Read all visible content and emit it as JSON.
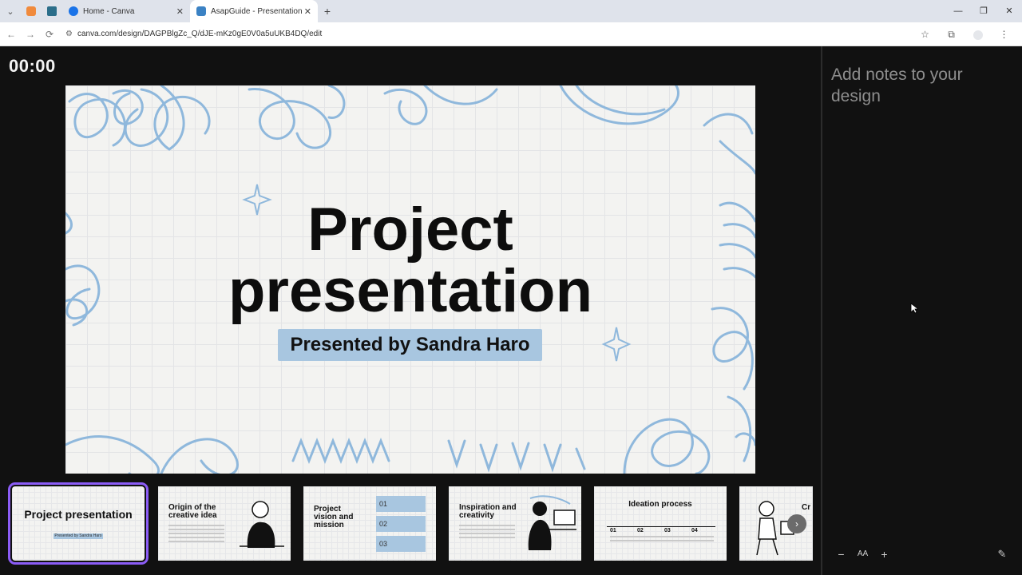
{
  "browser": {
    "tabs": [
      {
        "label": "Home - Canva",
        "active": false
      },
      {
        "label": "AsapGuide - Presentation",
        "active": true
      }
    ],
    "url": "canva.com/design/DAGPBlgZc_Q/dJE-mKz0gE0V0a5uUKB4DQ/edit",
    "icons": {
      "back": "←",
      "forward": "→",
      "reload": "⟳",
      "star": "☆",
      "ext": "⧉",
      "menu": "⋮",
      "minimize": "—",
      "restore": "❐",
      "close": "✕",
      "new_tab": "+",
      "tab_close": "✕",
      "tab_list": "⌄"
    }
  },
  "presenter": {
    "timer": "00:00",
    "slide": {
      "title_line1": "Project",
      "title_line2": "presentation",
      "subtitle": "Presented by Sandra Haro"
    },
    "thumbnails": [
      {
        "title": "Project presentation",
        "subtitle": "Presented by Sandra Haro",
        "selected": true
      },
      {
        "title": "Origin of the creative idea"
      },
      {
        "title": "Project vision and mission",
        "items": [
          "01",
          "02",
          "03"
        ]
      },
      {
        "title": "Inspiration and creativity"
      },
      {
        "title": "Ideation process",
        "steps": [
          "01",
          "02",
          "03",
          "04"
        ]
      },
      {
        "title": "Cr pr"
      }
    ],
    "next_icon": "›"
  },
  "notes": {
    "placeholder": "Add notes to your design",
    "controls": {
      "decrease": "−",
      "font_size": "AA",
      "increase": "+"
    },
    "edit_icon": "✎"
  },
  "colors": {
    "accent": "#8b5cf6",
    "highlight": "#a8c6e0",
    "doodle": "#8fb8dc"
  }
}
